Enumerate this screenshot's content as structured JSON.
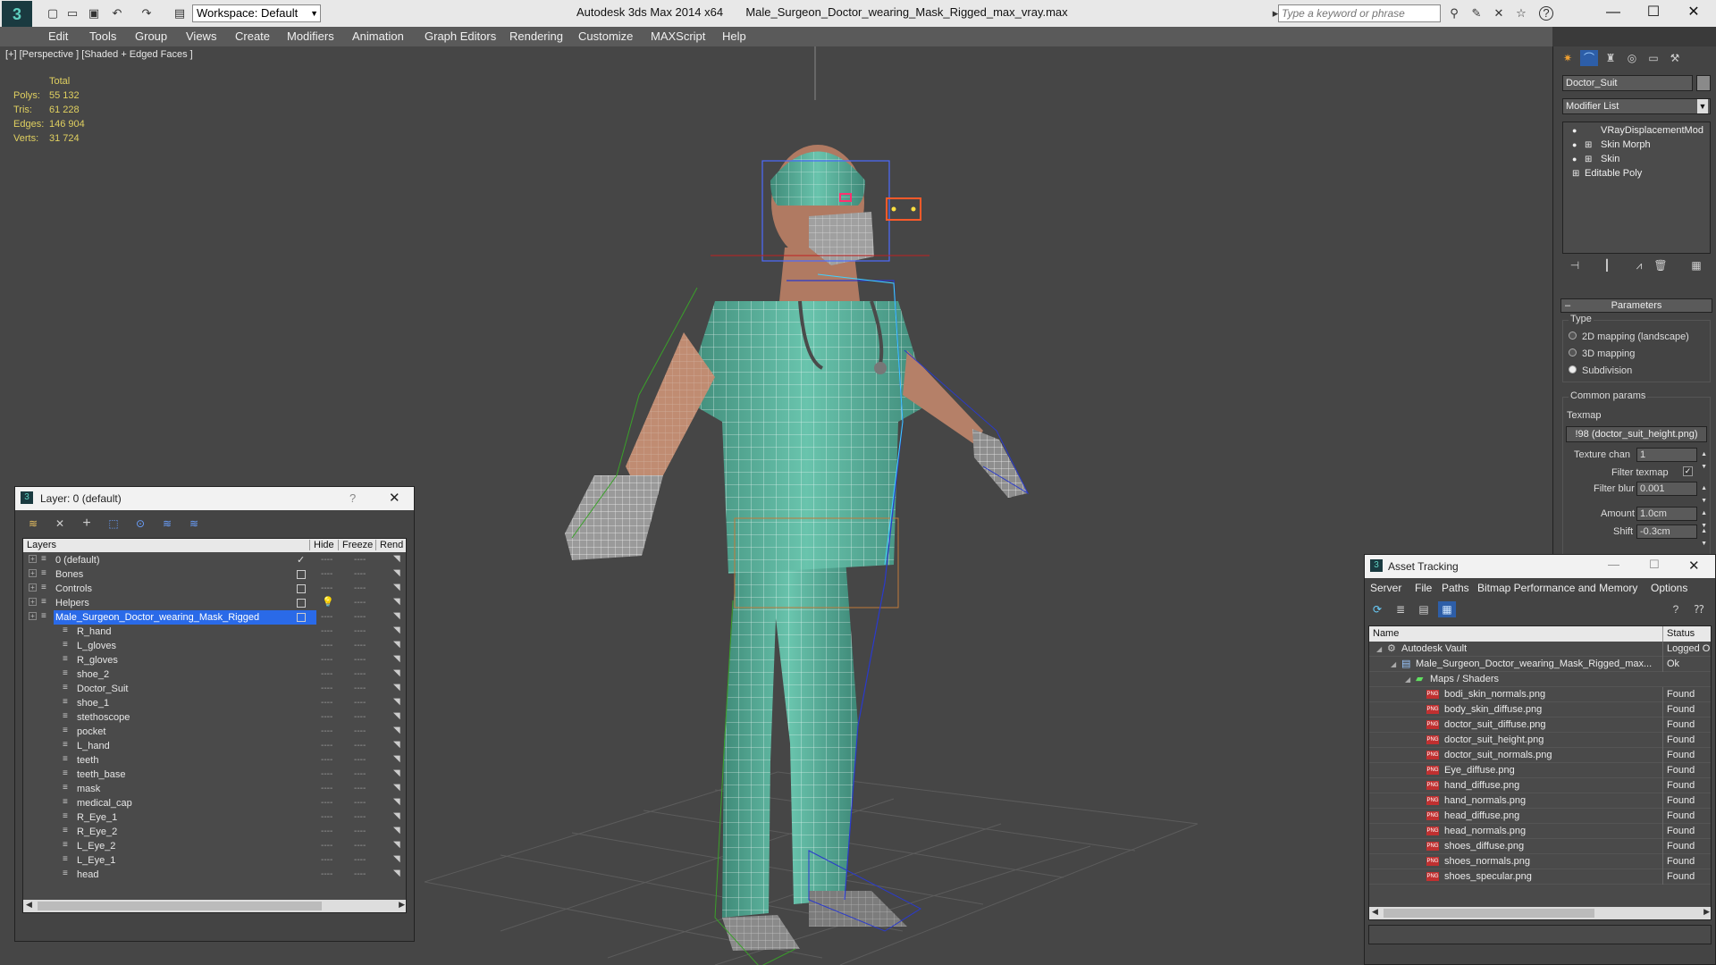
{
  "window": {
    "app_title": "Autodesk 3ds Max  2014 x64",
    "file_title": "Male_Surgeon_Doctor_wearing_Mask_Rigged_max_vray.max",
    "workspace": "Workspace: Default",
    "search_placeholder": "Type a keyword or phrase"
  },
  "menu": [
    "Edit",
    "Tools",
    "Group",
    "Views",
    "Create",
    "Modifiers",
    "Animation",
    "Graph Editors",
    "Rendering",
    "Customize",
    "MAXScript",
    "Help"
  ],
  "viewport": {
    "label": "[+] [Perspective ] [Shaded + Edged Faces ]",
    "stats": {
      "total_label": "Total",
      "polys_label": "Polys:",
      "polys": "55 132",
      "tris_label": "Tris:",
      "tris": "61 228",
      "edges_label": "Edges:",
      "edges": "146 904",
      "verts_label": "Verts:",
      "verts": "31 724"
    }
  },
  "command_panel": {
    "object_name": "Doctor_Suit",
    "modifier_list": "Modifier List",
    "stack": [
      "VRayDisplacementMod",
      "Skin Morph",
      "Skin",
      "Editable Poly"
    ],
    "parameters_title": "Parameters",
    "type_label": "Type",
    "type_options": [
      "2D mapping (landscape)",
      "3D mapping",
      "Subdivision"
    ],
    "common_params": "Common params",
    "texmap_label": "Texmap",
    "texmap_value": "!98 (doctor_suit_height.png)",
    "texture_chan_label": "Texture chan",
    "texture_chan_value": "1",
    "filter_texmap_label": "Filter texmap",
    "filter_blur_label": "Filter blur",
    "filter_blur_value": "0.001",
    "amount_label": "Amount",
    "amount_value": "1.0cm",
    "shift_label": "Shift",
    "shift_value": "-0.3cm"
  },
  "layer_dialog": {
    "title": "Layer: 0 (default)",
    "help": "?",
    "columns": [
      "Layers",
      "Hide",
      "Freeze",
      "Rend"
    ],
    "layers": [
      {
        "name": "0 (default)",
        "level": 0
      },
      {
        "name": "Bones",
        "level": 0
      },
      {
        "name": "Controls",
        "level": 0
      },
      {
        "name": "Helpers",
        "level": 0
      },
      {
        "name": "Male_Surgeon_Doctor_wearing_Mask_Rigged",
        "level": 0
      },
      {
        "name": "R_hand",
        "level": 1
      },
      {
        "name": "L_gloves",
        "level": 1
      },
      {
        "name": "R_gloves",
        "level": 1
      },
      {
        "name": "shoe_2",
        "level": 1
      },
      {
        "name": "Doctor_Suit",
        "level": 1
      },
      {
        "name": "shoe_1",
        "level": 1
      },
      {
        "name": "stethoscope",
        "level": 1
      },
      {
        "name": "pocket",
        "level": 1
      },
      {
        "name": "L_hand",
        "level": 1
      },
      {
        "name": "teeth",
        "level": 1
      },
      {
        "name": "teeth_base",
        "level": 1
      },
      {
        "name": "mask",
        "level": 1
      },
      {
        "name": "medical_cap",
        "level": 1
      },
      {
        "name": "R_Eye_1",
        "level": 1
      },
      {
        "name": "R_Eye_2",
        "level": 1
      },
      {
        "name": "L_Eye_2",
        "level": 1
      },
      {
        "name": "L_Eye_1",
        "level": 1
      },
      {
        "name": "head",
        "level": 1
      }
    ]
  },
  "asset_tracking": {
    "title": "Asset Tracking",
    "menu": [
      "Server",
      "File",
      "Paths",
      "Bitmap Performance and Memory",
      "Options"
    ],
    "columns": [
      "Name",
      "Status"
    ],
    "rows": [
      {
        "name": "Autodesk Vault",
        "status": "Logged O",
        "level": 0
      },
      {
        "name": "Male_Surgeon_Doctor_wearing_Mask_Rigged_max...",
        "status": "Ok",
        "level": 1
      },
      {
        "name": "Maps / Shaders",
        "status": "",
        "level": 2
      },
      {
        "name": "bodi_skin_normals.png",
        "status": "Found",
        "level": 3
      },
      {
        "name": "body_skin_diffuse.png",
        "status": "Found",
        "level": 3
      },
      {
        "name": "doctor_suit_diffuse.png",
        "status": "Found",
        "level": 3
      },
      {
        "name": "doctor_suit_height.png",
        "status": "Found",
        "level": 3
      },
      {
        "name": "doctor_suit_normals.png",
        "status": "Found",
        "level": 3
      },
      {
        "name": "Eye_diffuse.png",
        "status": "Found",
        "level": 3
      },
      {
        "name": "hand_diffuse.png",
        "status": "Found",
        "level": 3
      },
      {
        "name": "hand_normals.png",
        "status": "Found",
        "level": 3
      },
      {
        "name": "head_diffuse.png",
        "status": "Found",
        "level": 3
      },
      {
        "name": "head_normals.png",
        "status": "Found",
        "level": 3
      },
      {
        "name": "shoes_diffuse.png",
        "status": "Found",
        "level": 3
      },
      {
        "name": "shoes_normals.png",
        "status": "Found",
        "level": 3
      },
      {
        "name": "shoes_specular.png",
        "status": "Found",
        "level": 3
      }
    ]
  },
  "colors": {
    "suit": "#5fb8a0",
    "selection": "#2a6ae8",
    "stats_text": "#e0d060"
  }
}
